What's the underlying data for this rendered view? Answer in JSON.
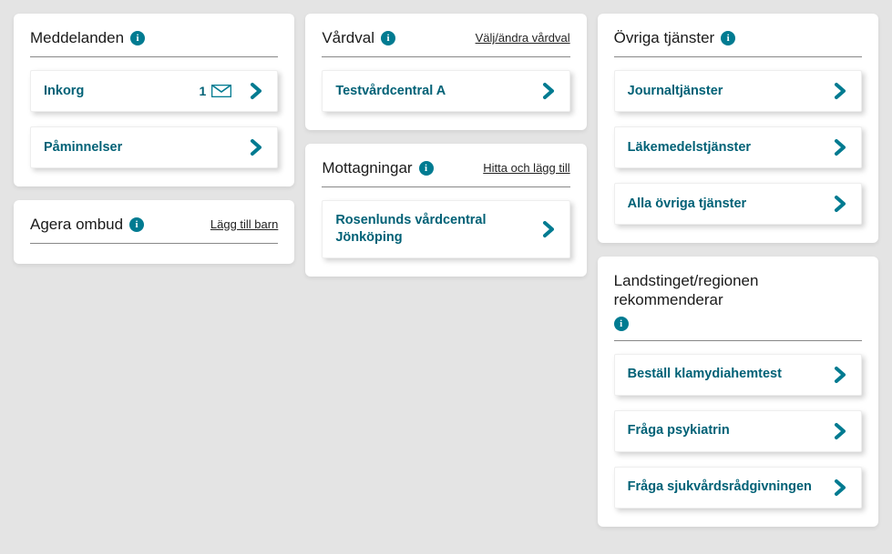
{
  "columns": [
    {
      "cards": [
        {
          "id": "meddelanden",
          "title": "Meddelanden",
          "info": true,
          "items": [
            {
              "label": "Inkorg",
              "count": "1",
              "mail": true
            },
            {
              "label": "Påminnelser"
            }
          ]
        },
        {
          "id": "agera-ombud",
          "title": "Agera ombud",
          "info": true,
          "link": "Lägg till barn",
          "items": []
        }
      ]
    },
    {
      "cards": [
        {
          "id": "vardval",
          "title": "Vårdval",
          "info": true,
          "link": "Välj/ändra vårdval",
          "items": [
            {
              "label": "Testvårdcentral A"
            }
          ]
        },
        {
          "id": "mottagningar",
          "title": "Mottagningar",
          "info": true,
          "link": "Hitta och lägg till",
          "items": [
            {
              "label": "Rosenlunds vårdcentral Jönköping"
            }
          ]
        }
      ]
    },
    {
      "cards": [
        {
          "id": "ovriga-tjanster",
          "title": "Övriga tjänster",
          "info": true,
          "items": [
            {
              "label": "Journaltjänster"
            },
            {
              "label": "Läkemedelstjänster"
            },
            {
              "label": "Alla övriga tjänster"
            }
          ]
        },
        {
          "id": "landstinget",
          "title": "Landstinget/regionen rekommenderar",
          "info": true,
          "items": [
            {
              "label": "Beställ klamydiahemtest"
            },
            {
              "label": "Fråga psykiatrin"
            },
            {
              "label": "Fråga sjukvårdsrådgivningen"
            }
          ]
        }
      ]
    }
  ]
}
